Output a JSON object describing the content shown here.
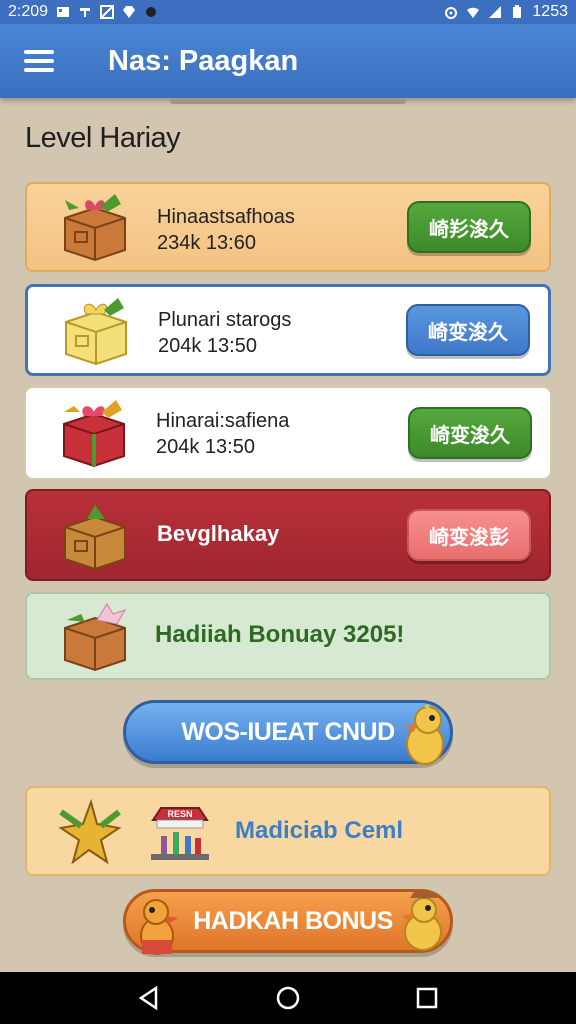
{
  "status_bar": {
    "time": "2:209",
    "right_text": "1253"
  },
  "app_bar": {
    "title": "Nas: Paagkan"
  },
  "section": {
    "title": "Level Hariay"
  },
  "rewards": [
    {
      "name": "Hinaastsafhoas",
      "meta": "234k  13:60",
      "button": "崎羏浚久",
      "style": "orange"
    },
    {
      "name": "Plunari starogs",
      "meta": "204k  13:50",
      "button": "崎变浚久",
      "style": "white-selected"
    },
    {
      "name": "Hinarai:safiena",
      "meta": "204k  13:50",
      "button": "崎变浚久",
      "style": "white"
    },
    {
      "name": "Bevglhakay",
      "button": "崎变浚彭",
      "style": "red"
    }
  ],
  "bonus_banner": {
    "text": "Hadiiah Bonuay 3205!"
  },
  "pill_blue": {
    "label": "WOS-IUEAT CNUD"
  },
  "shop_card": {
    "sign_text": "RESN",
    "text": "Madiciab Ceml"
  },
  "pill_orange": {
    "label": "HADKAH BONUS"
  },
  "nav": {
    "back": "back-icon",
    "home": "home-icon",
    "recents": "recents-icon"
  },
  "colors": {
    "app_bar": "#3a6fbf",
    "background": "#d2c6b0",
    "green_button": "#3c8a2a",
    "blue_button": "#3e78c8",
    "pink_button": "#ea6e6e"
  }
}
